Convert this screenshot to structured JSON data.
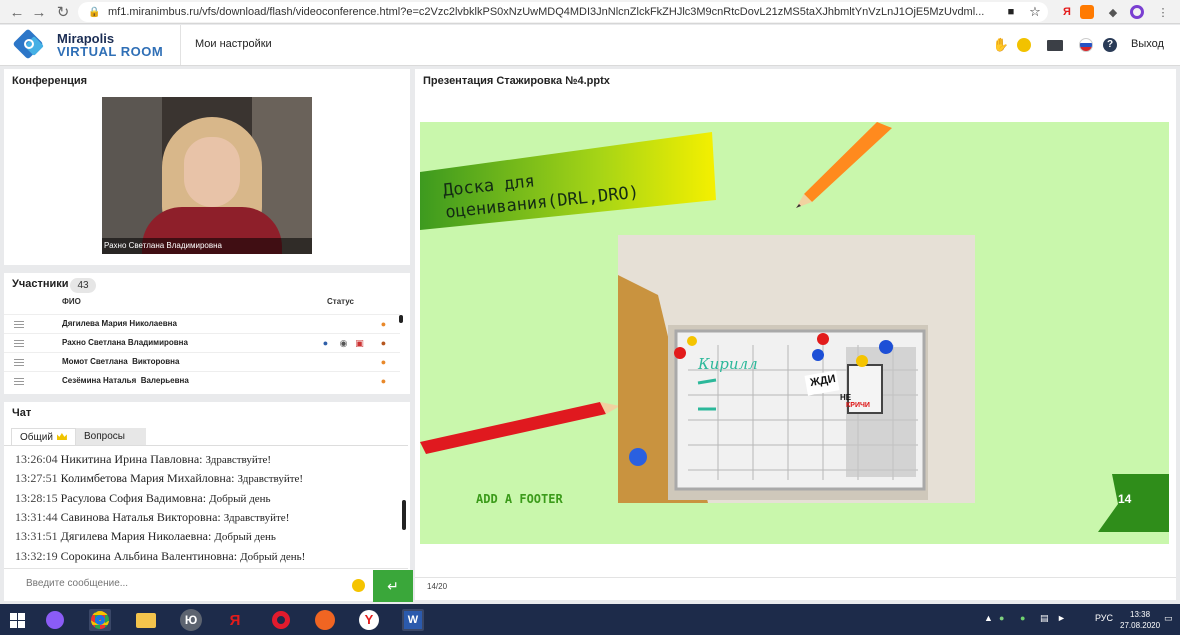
{
  "browser": {
    "url": "mf1.miranimbus.ru/vfs/download/flash/videoconference.html?e=c2Vzc2lvbklkPS0xNzUwMDQ4MDI3JnNlcnZlckFkZHJlc3M9cnRtcDovL21zMS5taXJhbmltYnVzLnJ1OjE5MzUvdml..."
  },
  "app": {
    "logo_line1": "Mirapolis",
    "logo_line2": "VIRTUAL ROOM",
    "settings_label": "Мои настройки",
    "exit_label": "Выход"
  },
  "conference": {
    "title": "Конференция",
    "speaker_name": "Рахно Светлана Владимировна"
  },
  "participants": {
    "title": "Участники",
    "count": "43",
    "col_name": "ФИО",
    "col_status": "Статус",
    "rows": [
      {
        "name": "Дягилева Мария Николаевна"
      },
      {
        "name": "Рахно Светлана Владимировна"
      },
      {
        "name": "Момот Светлана  Викторовна"
      },
      {
        "name": "Сезёмина Наталья  Валерьевна"
      }
    ]
  },
  "chat": {
    "title": "Чат",
    "tab_general": "Общий",
    "tab_questions": "Вопросы",
    "messages": [
      {
        "time": "13:26:04",
        "name": "Никитина Ирина  Павловна:",
        "text": "Здравствуйте!"
      },
      {
        "time": "13:27:51",
        "name": "Колимбетова Мария  Михайловна:",
        "text": "Здравствуйте!"
      },
      {
        "time": "13:28:15",
        "name": "Расулова  София Вадимовна:",
        "text": "Добрый день"
      },
      {
        "time": "13:31:44",
        "name": "Савинова Наталья  Викторовна:",
        "text": "Здравствуйте!"
      },
      {
        "time": "13:31:51",
        "name": "Дягилева Мария Николаевна:",
        "text": "Добрый день"
      },
      {
        "time": "13:32:19",
        "name": "Сорокина Альбина  Валентиновна:",
        "text": "Добрый день!"
      }
    ],
    "input_placeholder": "Введите сообщение..."
  },
  "presentation": {
    "title": "Презентация Стажировка №4.pptx",
    "slide_title_line1": "Доска для",
    "slide_title_line2": "оценивания(DRL,DRO)",
    "photo_label_name": "Кирилл",
    "photo_label_zhdi": "ЖДИ",
    "photo_label_nekrichi_1": "НЕ",
    "photo_label_nekrichi_2": "КРИЧИ",
    "slide_footer": "ADD A FOOTER",
    "slide_number": "14",
    "page_indicator": "14/20"
  },
  "taskbar": {
    "lang": "РУС",
    "time": "13:38",
    "date": "27.08.2020"
  },
  "colors": {
    "send_button": "#3aa73a",
    "slide_bg": "#c9f7ac",
    "taskbar": "#1d2b4a"
  }
}
